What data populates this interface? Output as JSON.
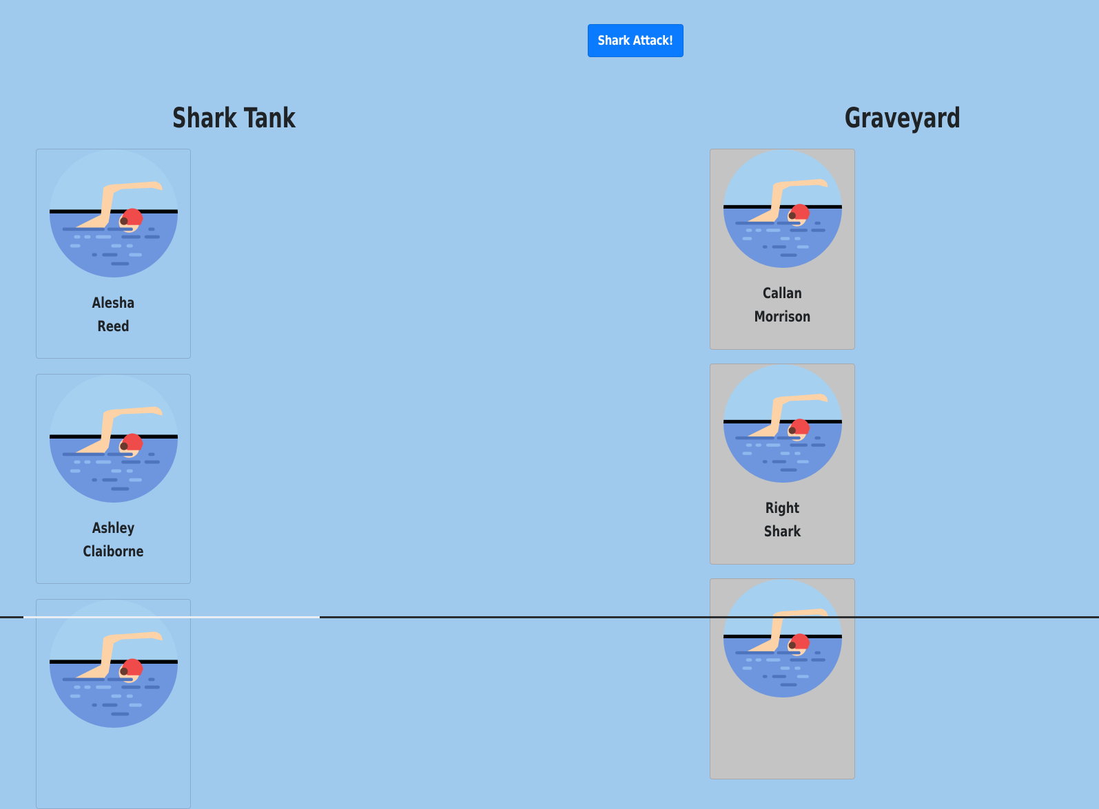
{
  "toolbar": {
    "attack_label": "Shark Attack!"
  },
  "tank": {
    "title": "Shark Tank",
    "cards": [
      {
        "first": "Alesha",
        "last": "Reed"
      },
      {
        "first": "Ashley",
        "last": "Claiborne"
      }
    ]
  },
  "graveyard": {
    "title": "Graveyard",
    "cards": [
      {
        "first": "Callan",
        "last": "Morrison"
      },
      {
        "first": "Right",
        "last": "Shark"
      }
    ]
  },
  "icons": {
    "card_avatar": "swimmer-icon"
  },
  "colors": {
    "background": "#a0c9ee",
    "button": "#0a7bff",
    "dead_card": "#c4c4c4",
    "water": "#6e96de",
    "cap": "#ef4b4b"
  }
}
